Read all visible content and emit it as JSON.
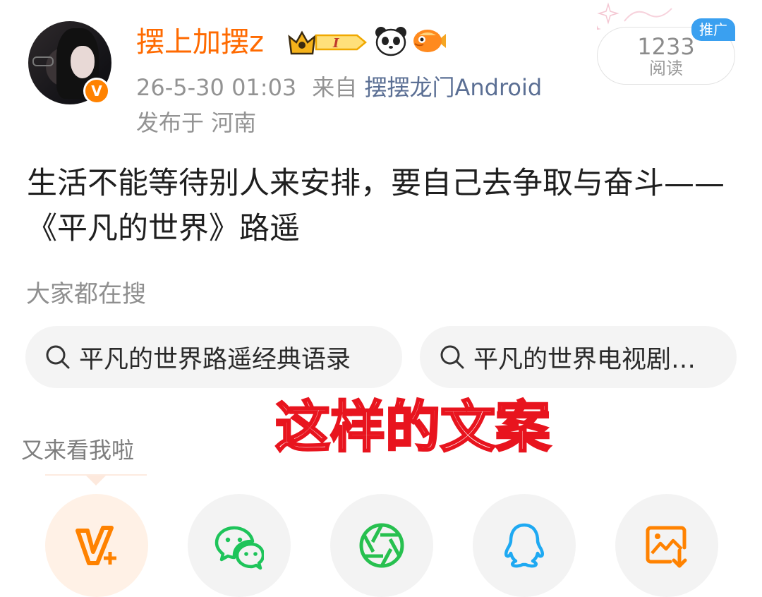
{
  "user": {
    "name": "摆上加摆z",
    "verified_badge": "V",
    "badges": [
      "crown-level-icon",
      "panda-icon",
      "fish-icon"
    ],
    "level_letter": "I"
  },
  "post_meta": {
    "time": "26-5-30 01:03",
    "from_label": "来自",
    "source": "摆摆龙门Android",
    "location": "发布于 河南"
  },
  "read_stat": {
    "count": "1233",
    "label": "阅读",
    "promo_tag": "推广"
  },
  "post": {
    "text": "生活不能等待别人来安排，要自己去争取与奋斗——《平凡的世界》路遥"
  },
  "search": {
    "heading": "大家都在搜",
    "chips": [
      {
        "label": "平凡的世界路遥经典语录"
      },
      {
        "label": "平凡的世界电视剧…"
      }
    ]
  },
  "overlay": {
    "caption": "这样的文案"
  },
  "share": {
    "prompt": "又来看我啦",
    "buttons": [
      {
        "icon": "vplus-icon"
      },
      {
        "icon": "wechat-icon"
      },
      {
        "icon": "moments-icon"
      },
      {
        "icon": "qq-icon"
      },
      {
        "icon": "save-image-icon"
      }
    ]
  },
  "colors": {
    "username": "#ff6a00",
    "source_link": "#5b6f94",
    "promo": "#3aa0f0",
    "caption_stroke": "#e8141e",
    "wechat": "#1ec45a",
    "moments": "#27c04f",
    "qq": "#1ea9f2",
    "vplus": "#ff8200"
  }
}
